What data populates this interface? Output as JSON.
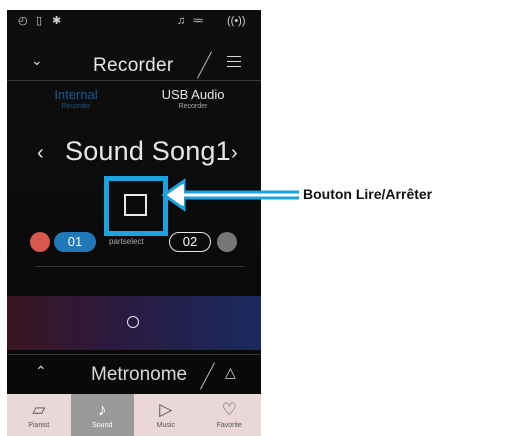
{
  "status_icons": [
    "headphones-icon",
    "usb-icon",
    "bluetooth-icon",
    "mic-icon",
    "sound-icon",
    "wireless-icon"
  ],
  "header": {
    "title": "Recorder"
  },
  "tabs": [
    {
      "label": "Internal",
      "sub": "Recorder",
      "active": true
    },
    {
      "label": "USB Audio",
      "sub": "Recorder",
      "active": false
    }
  ],
  "song": {
    "name": "Sound Song1"
  },
  "parts": {
    "part1": "01",
    "select_label": "partselect",
    "part2": "02"
  },
  "metronome": {
    "title": "Metronome"
  },
  "nav": [
    {
      "label": "Pianist"
    },
    {
      "label": "Sound"
    },
    {
      "label": "Music"
    },
    {
      "label": "Favorite"
    }
  ],
  "callout": {
    "label": "Bouton Lire/Arrêter"
  },
  "colors": {
    "accent": "#1aa3e0",
    "part1": "#2078b8",
    "rec_dot": "#d9574f"
  }
}
